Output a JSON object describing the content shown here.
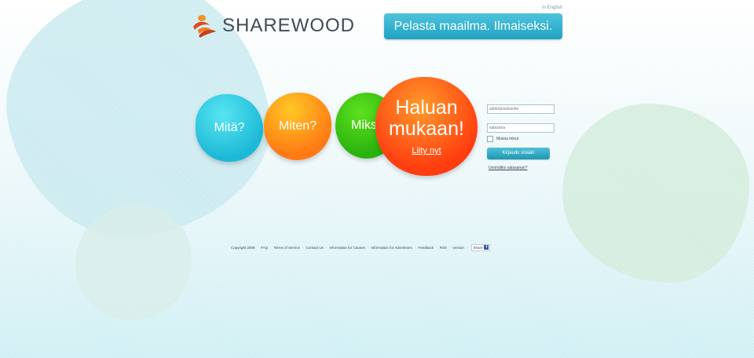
{
  "header": {
    "logo_text": "SHAREWOOD",
    "language_link": "In English",
    "slogan": "Pelasta maailma. Ilmaiseksi."
  },
  "bubbles": {
    "mita": "Mitä?",
    "miten": "Miten?",
    "miksi": "Miksi?",
    "haluan_title": "Haluan mukaan!",
    "haluan_link": "Liity nyt"
  },
  "login": {
    "email_placeholder": "sähköpostiosoite",
    "password_placeholder": "salasana",
    "remember_label": "Muista minut",
    "submit_label": "Kirjaudu sisään",
    "forgot_link": "Unohditko salasanan?"
  },
  "footer": {
    "copyright": "Copyright 2009",
    "links": [
      "FAQ",
      "Terms of Service",
      "Contact Us",
      "Information for Causes",
      "Information for Advertisers",
      "Feedback",
      "RSS",
      "version"
    ],
    "share_label": "Share",
    "share_icon": "facebook-icon"
  },
  "colors": {
    "slogan_bg": "#1ea3c4",
    "mita": "#1cb9d6",
    "miten": "#ff7a13",
    "miksi": "#29b20d",
    "haluan": "#ff3d10"
  }
}
